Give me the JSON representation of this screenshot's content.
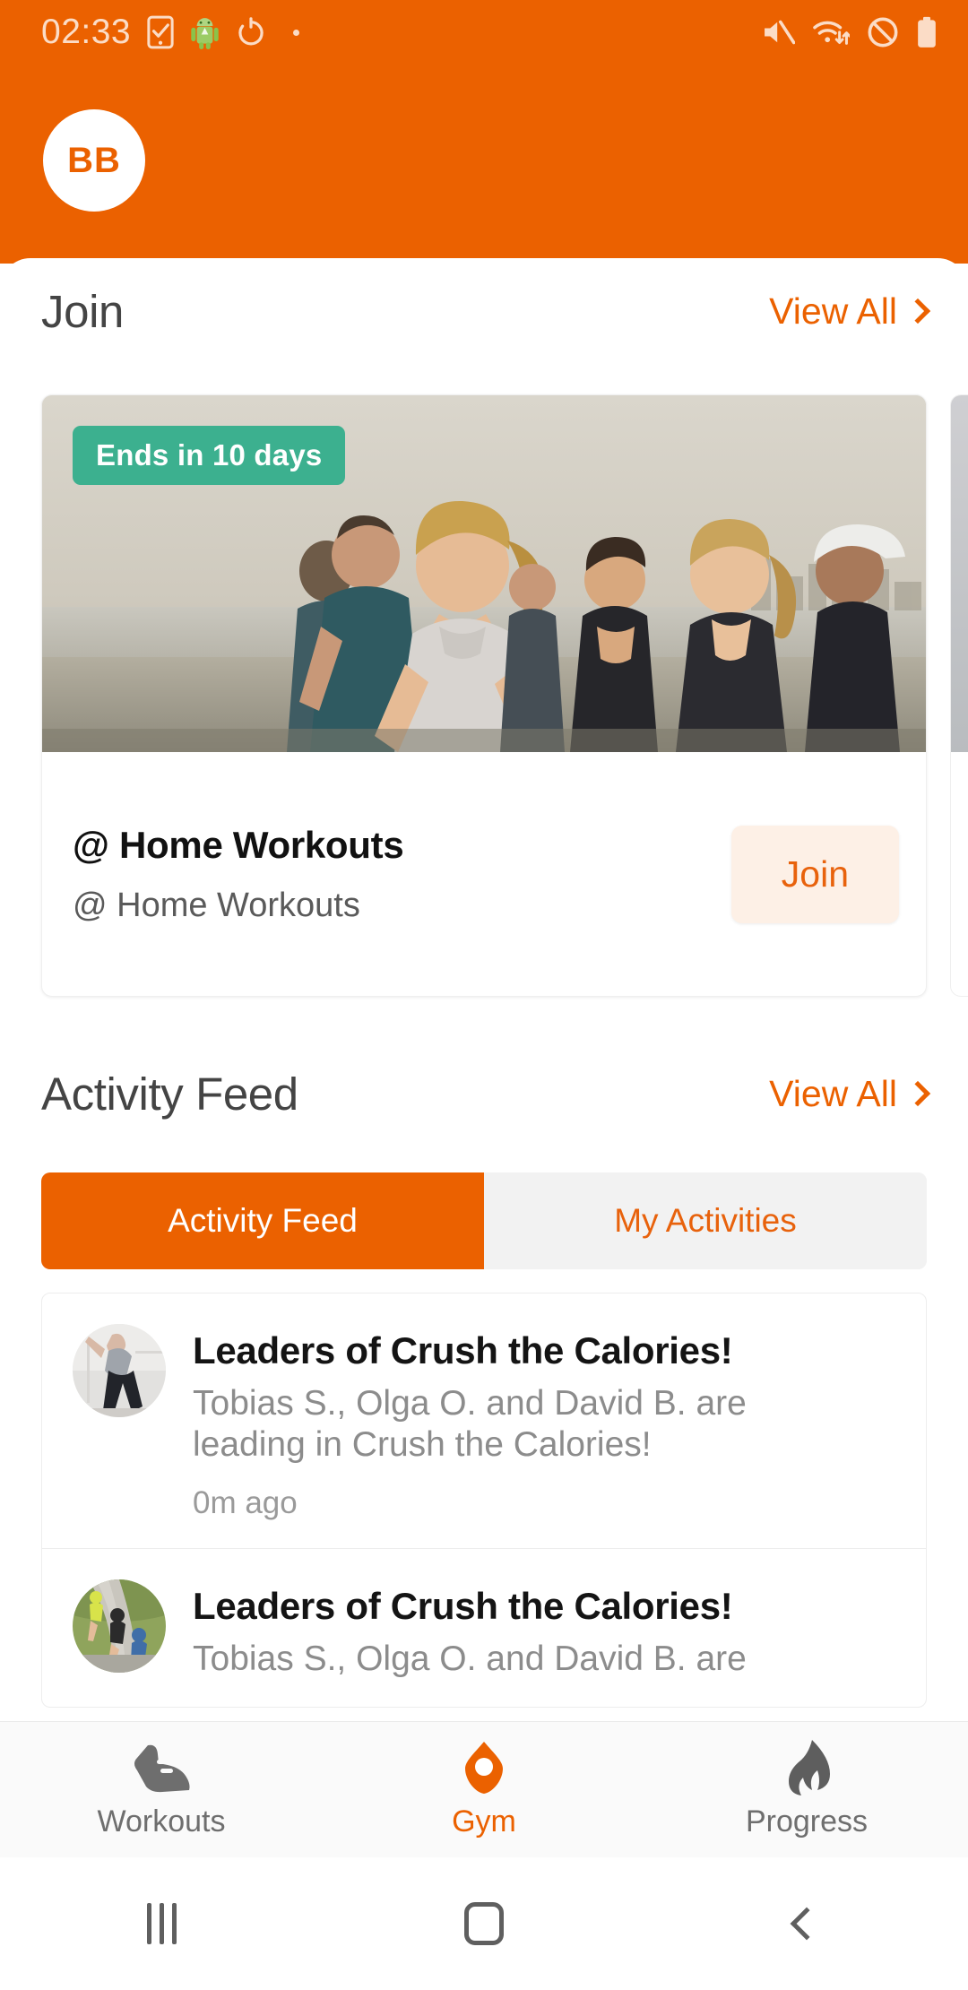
{
  "status_bar": {
    "time": "02:33",
    "left_icons": [
      "phone-check-icon",
      "android-robot-icon",
      "timer-reset-icon",
      "notification-dot"
    ],
    "right_icons": [
      "mute-icon",
      "wifi-data-icon",
      "do-not-disturb-icon",
      "battery-full-icon"
    ],
    "background_color": "#EB6100",
    "foreground_color": "#FBDCC6"
  },
  "header": {
    "avatar_initials": "BB",
    "avatar_background": "#FFFFFF",
    "avatar_text_color": "#EB6100",
    "background_color": "#EB6100"
  },
  "join_section": {
    "title": "Join",
    "view_all_label": "View All",
    "cards": [
      {
        "badge": "Ends in 10 days",
        "badge_color": "#3CB08F",
        "title": "@ Home Workouts",
        "subtitle": "@ Home Workouts",
        "action_label": "Join",
        "action_bg": "#FDF0E6",
        "action_color": "#E8620C",
        "photo_alt": "group of people running on a beach boardwalk"
      }
    ]
  },
  "activity_section": {
    "title": "Activity Feed",
    "view_all_label": "View All",
    "tabs": [
      {
        "label": "Activity Feed",
        "active": true
      },
      {
        "label": "My Activities",
        "active": false
      }
    ],
    "items": [
      {
        "title": "Leaders of Crush the Calories!",
        "body": "Tobias S., Olga O. and David B. are leading in Crush the Calories!",
        "time": "0m ago",
        "avatar_alt": "woman stretching in a studio"
      },
      {
        "title": "Leaders of Crush the Calories!",
        "body": "Tobias S., Olga O. and David B. are",
        "time": "",
        "avatar_alt": "runners on an outdoor path"
      }
    ]
  },
  "bottom_nav": {
    "items": [
      {
        "label": "Workouts",
        "icon": "shoe-icon",
        "active": false
      },
      {
        "label": "Gym",
        "icon": "gym-pin-icon",
        "active": true
      },
      {
        "label": "Progress",
        "icon": "flame-icon",
        "active": false
      }
    ],
    "active_color": "#EB6100",
    "inactive_color": "#6E6E6E"
  },
  "system_nav": {
    "recents_label": "recents-button",
    "home_label": "home-button",
    "back_label": "back-button"
  }
}
